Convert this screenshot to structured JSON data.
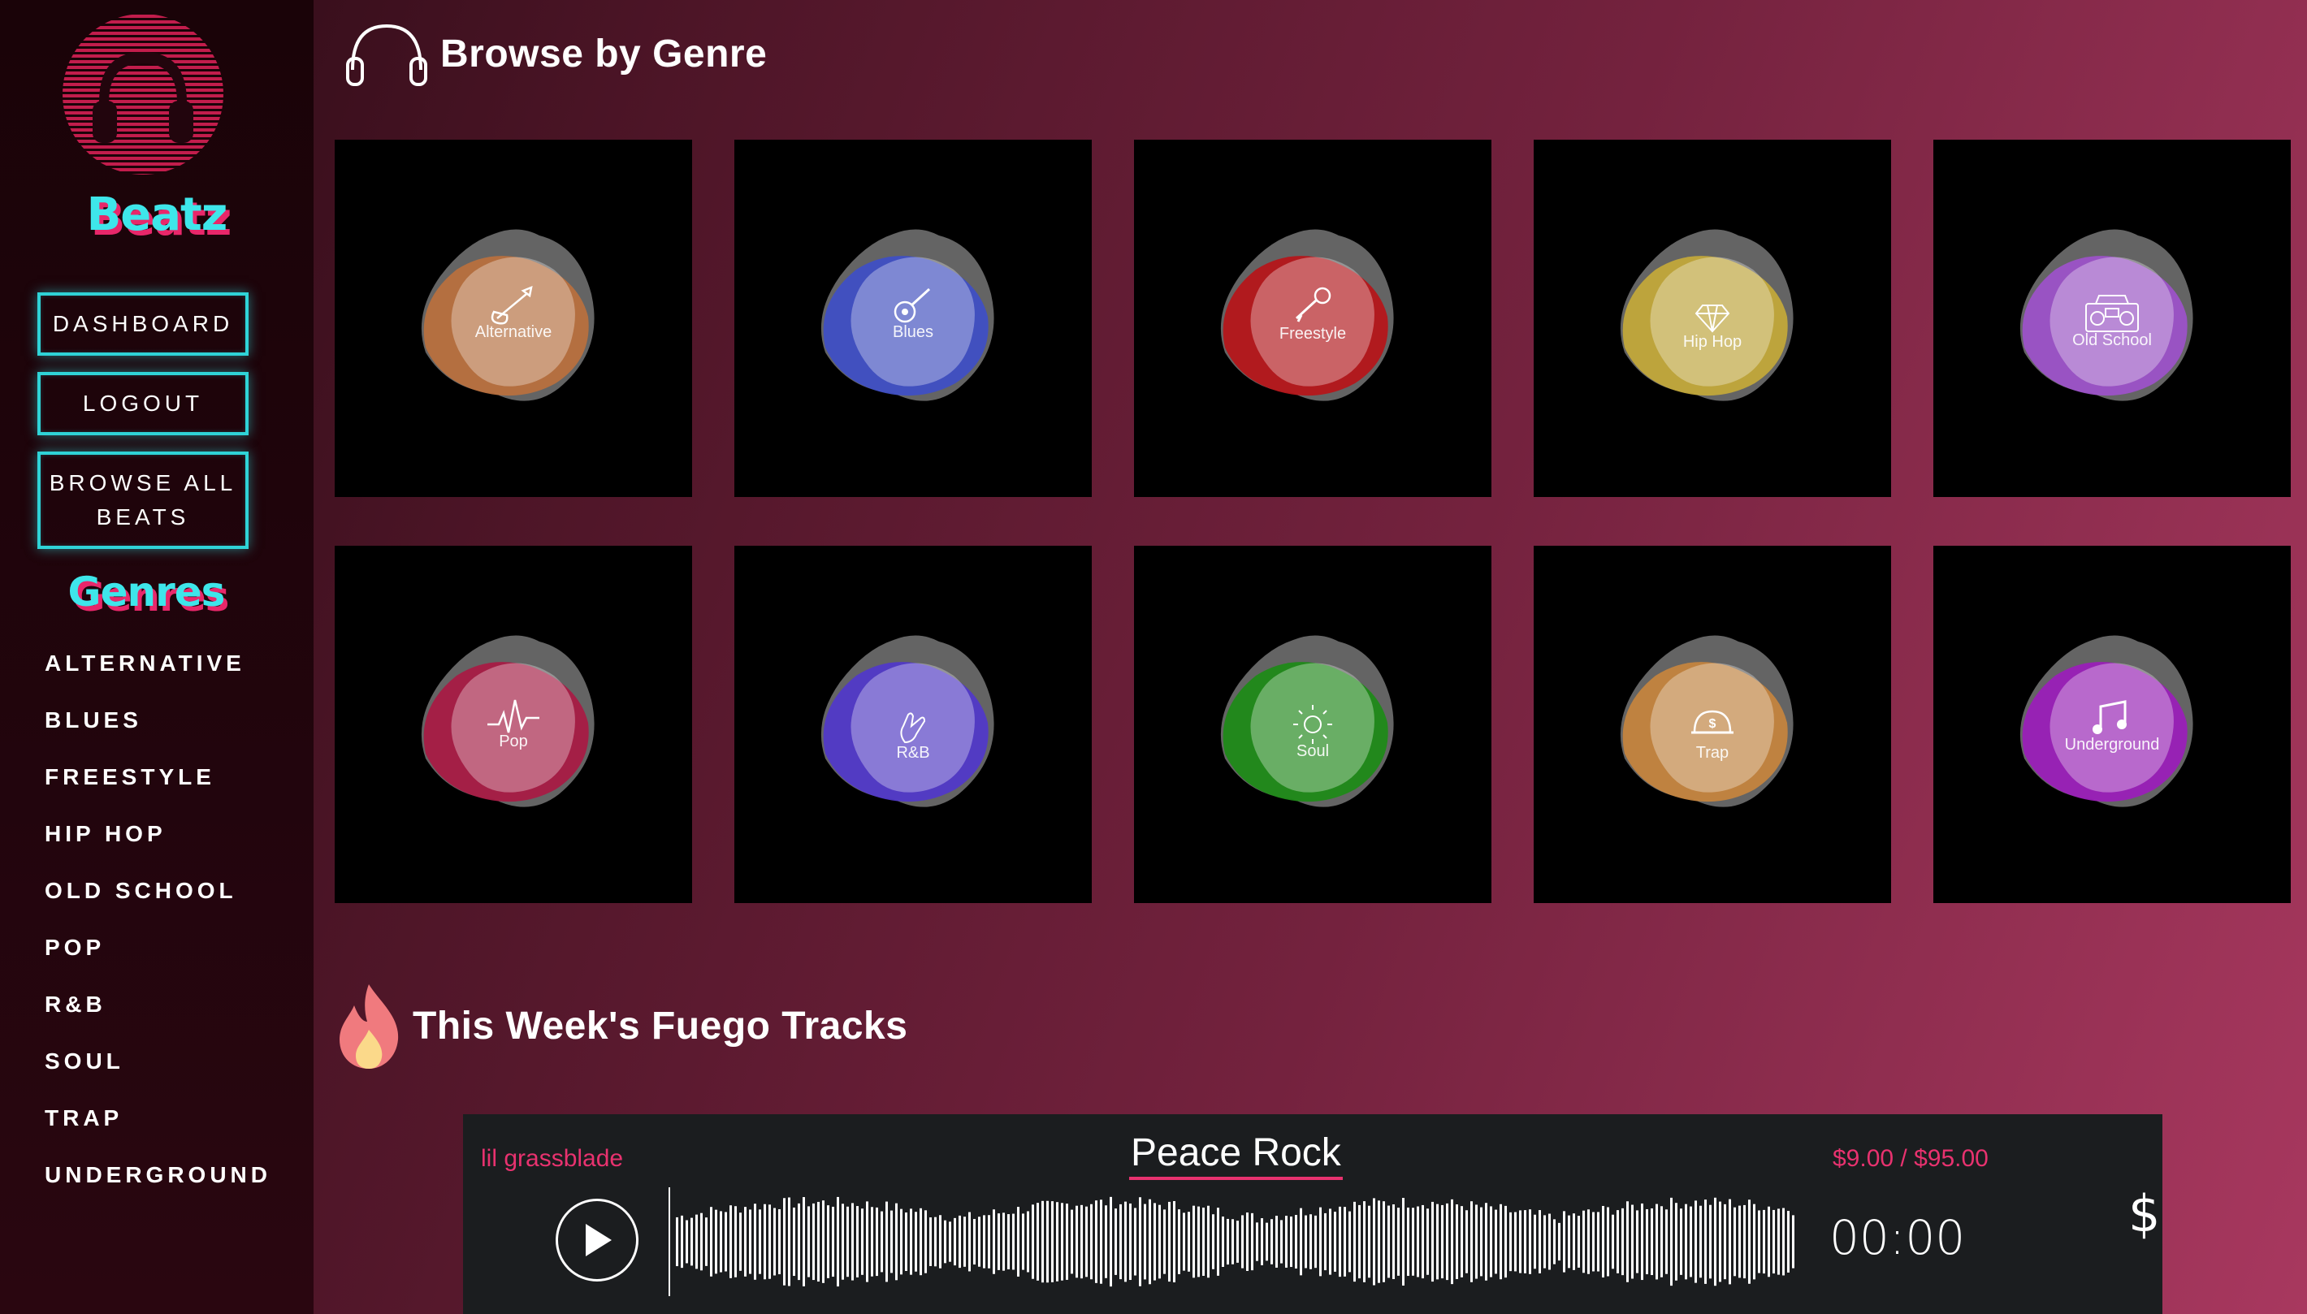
{
  "app": {
    "brand": "Beatz"
  },
  "sidebar": {
    "buttons": {
      "dashboard": "DASHBOARD",
      "logout": "LOGOUT",
      "browse_all": "BROWSE ALL BEATS"
    },
    "genres_title": "Genres",
    "genre_links": [
      "ALTERNATIVE",
      "BLUES",
      "FREESTYLE",
      "HIP HOP",
      "OLD SCHOOL",
      "POP",
      "R&B",
      "SOUL",
      "TRAP",
      "UNDERGROUND"
    ]
  },
  "main": {
    "browse_title": "Browse by Genre",
    "genres": [
      {
        "label": "Alternative",
        "icon": "guitar-icon",
        "color": "#b8703e"
      },
      {
        "label": "Blues",
        "icon": "banjo-icon",
        "color": "#3f4fc4"
      },
      {
        "label": "Freestyle",
        "icon": "microphone-icon",
        "color": "#b5161a"
      },
      {
        "label": "Hip Hop",
        "icon": "diamond-icon",
        "color": "#c2a83a"
      },
      {
        "label": "Old School",
        "icon": "boombox-icon",
        "color": "#9c52c8"
      },
      {
        "label": "Pop",
        "icon": "pulse-icon",
        "color": "#a81b44"
      },
      {
        "label": "R&B",
        "icon": "hand-icon",
        "color": "#5139c8"
      },
      {
        "label": "Soul",
        "icon": "sun-icon",
        "color": "#1f8a18"
      },
      {
        "label": "Trap",
        "icon": "cap-icon",
        "color": "#c4843e"
      },
      {
        "label": "Underground",
        "icon": "music-note-icon",
        "color": "#9a1fb8"
      }
    ],
    "fuego_title": "This Week's Fuego Tracks"
  },
  "player": {
    "artist": "lil grassblade",
    "title": "Peace Rock",
    "price": "$9.00 / $95.00",
    "time": "00:00",
    "buy_symbol": "$",
    "accent": "#e8326f"
  }
}
